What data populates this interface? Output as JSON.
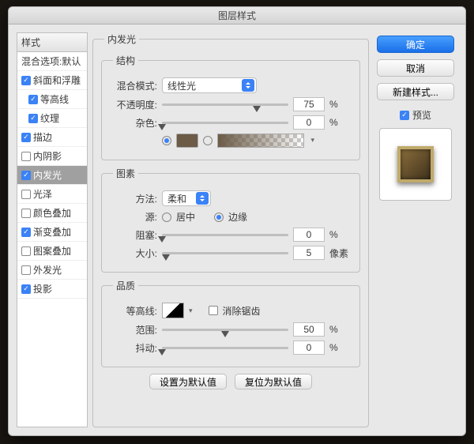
{
  "title": "图层样式",
  "styles": {
    "header": "样式",
    "blending": "混合选项:默认",
    "items": [
      "斜面和浮雕",
      "等高线",
      "纹理",
      "描边",
      "内阴影",
      "内发光",
      "光泽",
      "颜色叠加",
      "渐变叠加",
      "图案叠加",
      "外发光",
      "投影"
    ]
  },
  "panel": {
    "title": "内发光",
    "structure": {
      "title": "结构",
      "blendMode": {
        "label": "混合模式:",
        "value": "线性光"
      },
      "opacity": {
        "label": "不透明度:",
        "value": "75",
        "unit": "%"
      },
      "noise": {
        "label": "杂色:",
        "value": "0",
        "unit": "%"
      },
      "color": "#6b5b47"
    },
    "elements": {
      "title": "图素",
      "technique": {
        "label": "方法:",
        "value": "柔和"
      },
      "source": {
        "label": "源:",
        "center": "居中",
        "edge": "边缘",
        "selected": "edge"
      },
      "choke": {
        "label": "阻塞:",
        "value": "0",
        "unit": "%"
      },
      "size": {
        "label": "大小:",
        "value": "5",
        "unit": "像素"
      }
    },
    "quality": {
      "title": "品质",
      "contour": {
        "label": "等高线:"
      },
      "antialias": "消除锯齿",
      "range": {
        "label": "范围:",
        "value": "50",
        "unit": "%"
      },
      "jitter": {
        "label": "抖动:",
        "value": "0",
        "unit": "%"
      }
    },
    "buttons": {
      "makeDefault": "设置为默认值",
      "resetDefault": "复位为默认值"
    }
  },
  "right": {
    "ok": "确定",
    "cancel": "取消",
    "newStyle": "新建样式...",
    "preview": "预览"
  }
}
